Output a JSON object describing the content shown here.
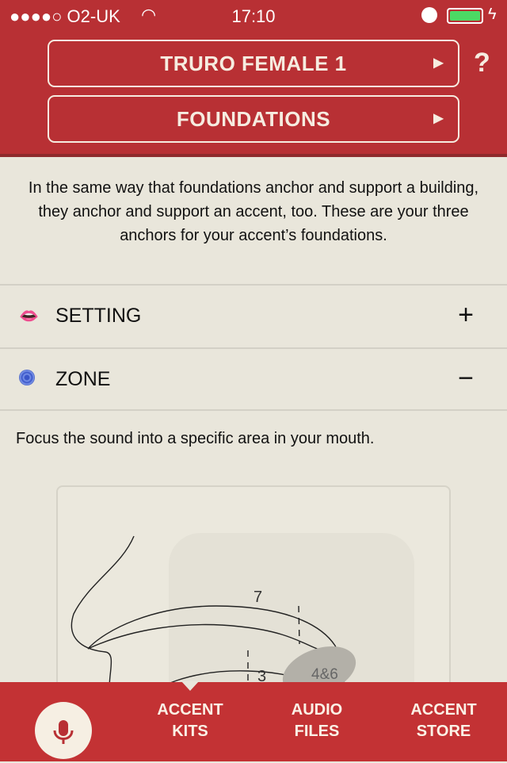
{
  "status_bar": {
    "carrier": "●●●●○ O2-UK",
    "time": "17:10",
    "battery_percent": 100,
    "icons": [
      "wifi-icon",
      "alarm-icon",
      "battery-icon",
      "charging-icon"
    ]
  },
  "header": {
    "accent_button": "TRURO FEMALE 1",
    "section_button": "FOUNDATIONS",
    "help": "?",
    "arrow": "▶"
  },
  "intro": "In the same way that foundations anchor and support a building, they anchor and support an accent, too. These are your three anchors for your accent’s foundations.",
  "sections": [
    {
      "label": "SETTING",
      "icon": "lips-icon",
      "toggle": "+",
      "expanded": false
    },
    {
      "label": "ZONE",
      "icon": "target-icon",
      "toggle": "−",
      "expanded": true
    }
  ],
  "zone": {
    "description": "Focus the sound into a specific area in your mouth.",
    "diagram_labels": [
      "7",
      "3",
      "4&6"
    ]
  },
  "tabbar": {
    "tabs": [
      {
        "line1": "ACCENT",
        "line2": "KITS"
      },
      {
        "line1": "AUDIO",
        "line2": "FILES"
      },
      {
        "line1": "ACCENT",
        "line2": "STORE"
      }
    ]
  },
  "colors": {
    "brand_red": "#b83034",
    "background": "#e9e6db",
    "cream": "#f6ece0"
  }
}
